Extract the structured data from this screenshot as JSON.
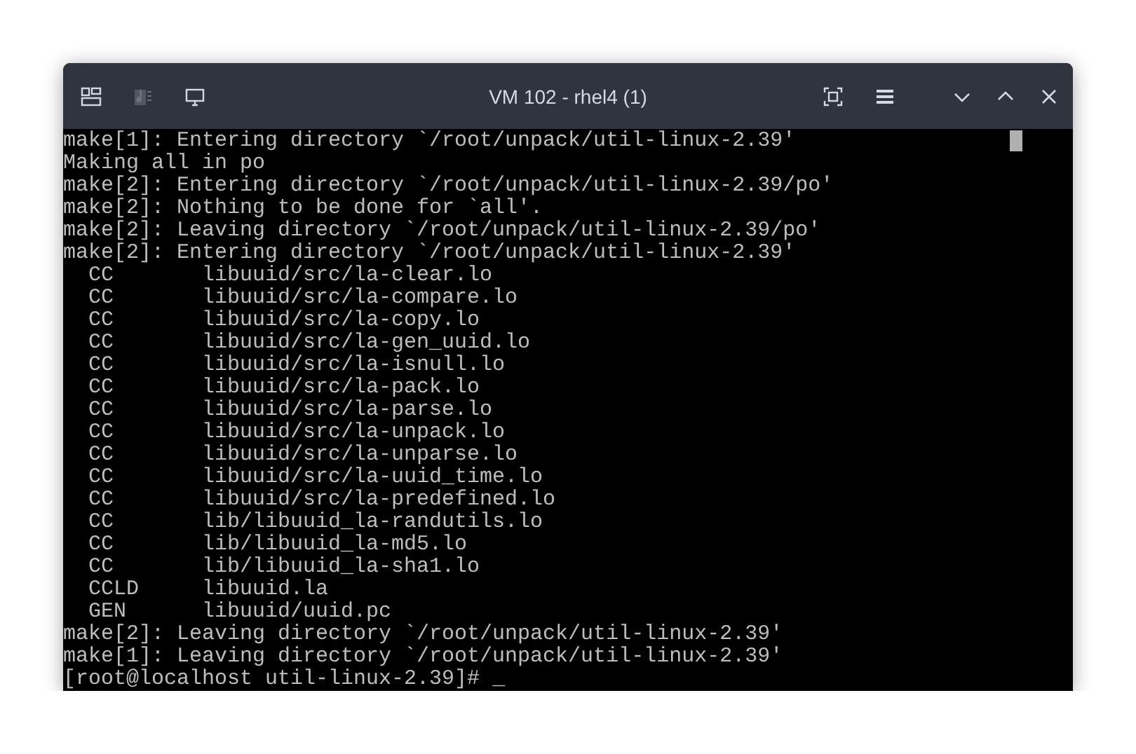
{
  "window": {
    "title": "VM 102 - rhel4 (1)"
  },
  "terminal": {
    "lines": [
      {
        "kind": "text",
        "text": "make[1]: Entering directory `/root/unpack/util-linux-2.39'"
      },
      {
        "kind": "text",
        "text": "Making all in po"
      },
      {
        "kind": "text",
        "text": "make[2]: Entering directory `/root/unpack/util-linux-2.39/po'"
      },
      {
        "kind": "text",
        "text": "make[2]: Nothing to be done for `all'."
      },
      {
        "kind": "text",
        "text": "make[2]: Leaving directory `/root/unpack/util-linux-2.39/po'"
      },
      {
        "kind": "text",
        "text": "make[2]: Entering directory `/root/unpack/util-linux-2.39'"
      },
      {
        "kind": "build",
        "tag": "CC",
        "target": "libuuid/src/la-clear.lo"
      },
      {
        "kind": "build",
        "tag": "CC",
        "target": "libuuid/src/la-compare.lo"
      },
      {
        "kind": "build",
        "tag": "CC",
        "target": "libuuid/src/la-copy.lo"
      },
      {
        "kind": "build",
        "tag": "CC",
        "target": "libuuid/src/la-gen_uuid.lo"
      },
      {
        "kind": "build",
        "tag": "CC",
        "target": "libuuid/src/la-isnull.lo"
      },
      {
        "kind": "build",
        "tag": "CC",
        "target": "libuuid/src/la-pack.lo"
      },
      {
        "kind": "build",
        "tag": "CC",
        "target": "libuuid/src/la-parse.lo"
      },
      {
        "kind": "build",
        "tag": "CC",
        "target": "libuuid/src/la-unpack.lo"
      },
      {
        "kind": "build",
        "tag": "CC",
        "target": "libuuid/src/la-unparse.lo"
      },
      {
        "kind": "build",
        "tag": "CC",
        "target": "libuuid/src/la-uuid_time.lo"
      },
      {
        "kind": "build",
        "tag": "CC",
        "target": "libuuid/src/la-predefined.lo"
      },
      {
        "kind": "build",
        "tag": "CC",
        "target": "lib/libuuid_la-randutils.lo"
      },
      {
        "kind": "build",
        "tag": "CC",
        "target": "lib/libuuid_la-md5.lo"
      },
      {
        "kind": "build",
        "tag": "CC",
        "target": "lib/libuuid_la-sha1.lo"
      },
      {
        "kind": "build",
        "tag": "CCLD",
        "target": "libuuid.la"
      },
      {
        "kind": "build",
        "tag": "GEN",
        "target": "libuuid/uuid.pc"
      },
      {
        "kind": "text",
        "text": "make[2]: Leaving directory `/root/unpack/util-linux-2.39'"
      },
      {
        "kind": "text",
        "text": "make[1]: Leaving directory `/root/unpack/util-linux-2.39'"
      },
      {
        "kind": "prompt",
        "text": "[root@localhost util-linux-2.39]# ",
        "cursor": "_"
      }
    ]
  }
}
